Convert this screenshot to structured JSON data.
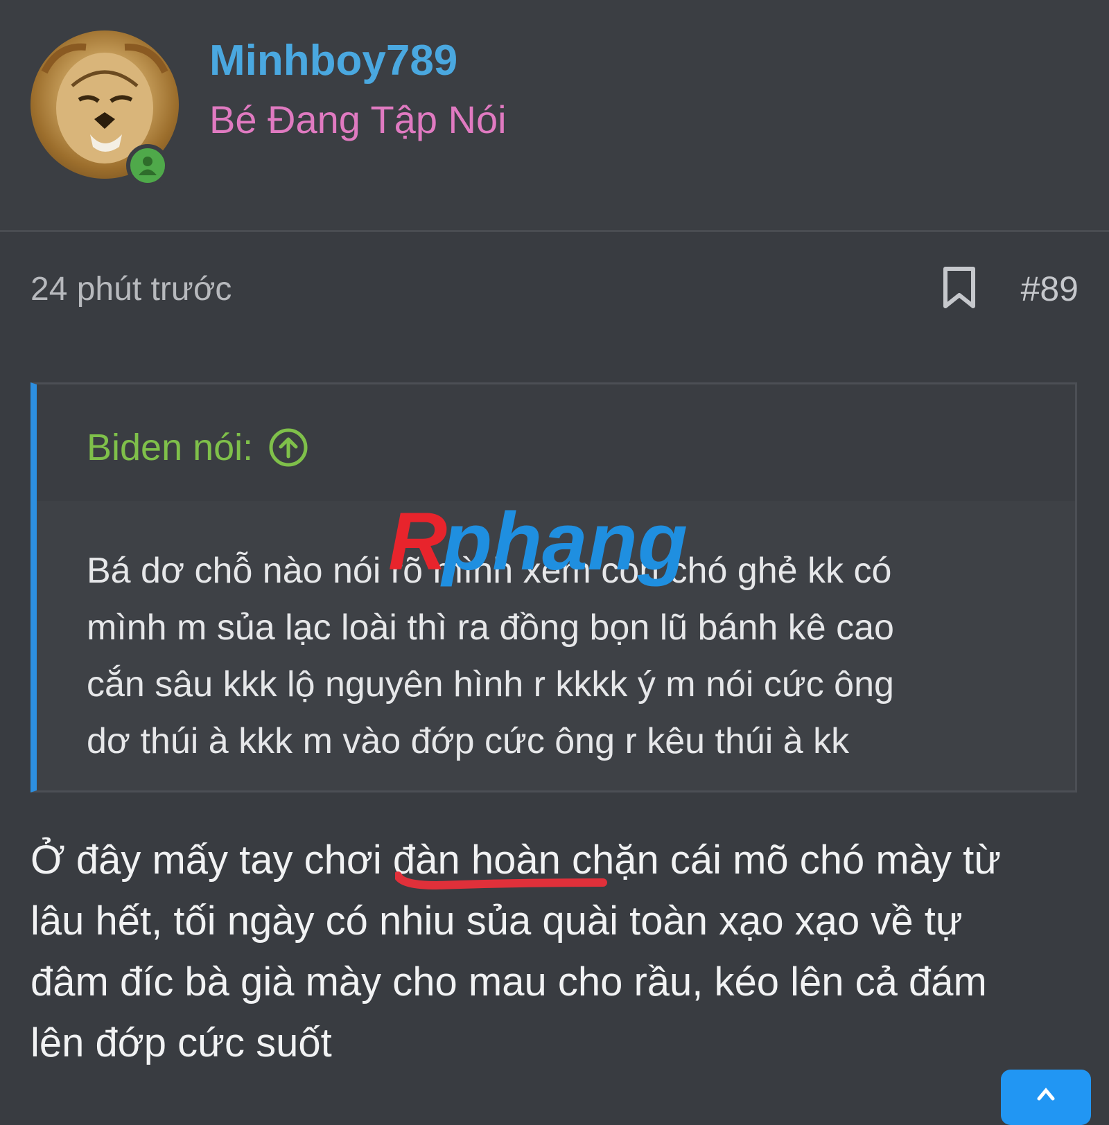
{
  "user": {
    "name": "Minhboy789",
    "title": "Bé Đang Tập Nói",
    "avatar_icon": "lion-avatar",
    "status_icon": "online-user-icon"
  },
  "post": {
    "time": "24 phút trước",
    "number": "#89",
    "bookmark_icon": "bookmark-icon"
  },
  "quote": {
    "author": "Biden nói:",
    "lines": [
      "Bá dơ chỗ nào nói rõ mình xem con chó ghẻ kk có",
      "mình m sủa lạc loài thì ra đồng bọn lũ bánh kê cao",
      "cắn sâu kkk lộ nguyên hình r kkkk ý m nói cức ông",
      "dơ thúi à kkk m vào đớp cức ông r kêu thúi à kk"
    ]
  },
  "body": {
    "lines": [
      "Ở đây mấy tay chơi đàn hoàn chặn cái mõ chó mày từ",
      "lâu hết, tối ngày có nhiu sủa quài toàn xạo xạo về tự",
      "đâm đíc bà già mày cho mau cho rầu, kéo lên cả đám",
      "lên đớp cức suốt"
    ]
  },
  "watermark": {
    "text": "Rphang"
  },
  "colors": {
    "username": "#4aa8e0",
    "title": "#e07ac1",
    "quote_author": "#7fc04a",
    "quote_bar": "#2d8fe0",
    "underline": "#e0303a",
    "fab": "#2196f3"
  }
}
